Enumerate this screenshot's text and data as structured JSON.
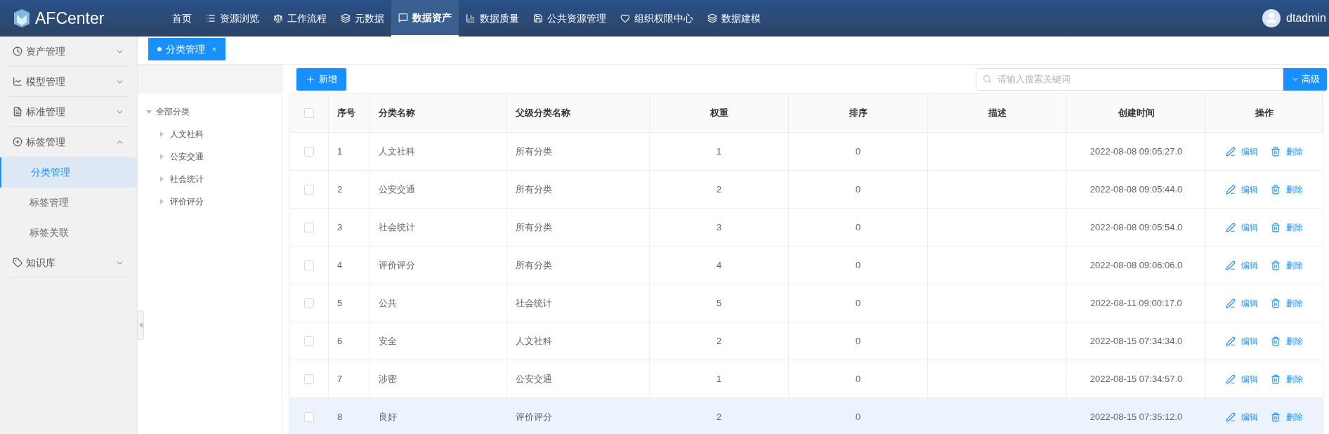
{
  "header": {
    "logo": "AFCenter",
    "nav": [
      {
        "label": "首页",
        "selected": false
      },
      {
        "label": "资源浏览",
        "selected": false
      },
      {
        "label": "工作流程",
        "selected": false
      },
      {
        "label": "元数据",
        "selected": false
      },
      {
        "label": "数据资产",
        "selected": true
      },
      {
        "label": "数据质量",
        "selected": false
      },
      {
        "label": "公共资源管理",
        "selected": false
      },
      {
        "label": "组织权限中心",
        "selected": false
      },
      {
        "label": "数据建模",
        "selected": false
      }
    ],
    "user": "dtadmin"
  },
  "sidebar": {
    "groups": [
      {
        "label": "资产管理",
        "expanded": false
      },
      {
        "label": "模型管理",
        "expanded": false
      },
      {
        "label": "标准管理",
        "expanded": false
      },
      {
        "label": "标签管理",
        "expanded": true,
        "items": [
          {
            "label": "分类管理",
            "selected": true
          },
          {
            "label": "标签管理",
            "selected": false
          },
          {
            "label": "标签关联",
            "selected": false
          }
        ]
      },
      {
        "label": "知识库",
        "expanded": false
      }
    ]
  },
  "open_tabs": [
    {
      "label": "分类管理",
      "close": "×",
      "selected": true
    }
  ],
  "tree": {
    "label": "全部分类",
    "expanded": true,
    "children": [
      {
        "label": "人文社科",
        "expanded": false
      },
      {
        "label": "公安交通",
        "expanded": false
      },
      {
        "label": "社会统计",
        "expanded": false
      },
      {
        "label": "评价评分",
        "expanded": false
      }
    ]
  },
  "toolbar": {
    "add_button": "新增",
    "search": {
      "placeholder": "请输入搜索关键词"
    },
    "advanced_button": "高级"
  },
  "table": {
    "all_checked": false,
    "columns": [
      "序号",
      "分类名称",
      "父级分类名称",
      "权重",
      "排序",
      "描述",
      "创建时间",
      "操作"
    ],
    "rows": [
      {
        "index": "1",
        "name": "人文社科",
        "parent": "所有分类",
        "weight": "1",
        "order": "0",
        "created": "2022-08-08 09:05:27.0",
        "edit": "编辑",
        "delete": "删除",
        "checked": false,
        "selected": false
      },
      {
        "index": "2",
        "name": "公安交通",
        "parent": "所有分类",
        "weight": "2",
        "order": "0",
        "created": "2022-08-08 09:05:44.0",
        "edit": "编辑",
        "delete": "删除",
        "checked": false,
        "selected": false
      },
      {
        "index": "3",
        "name": "社会统计",
        "parent": "所有分类",
        "weight": "3",
        "order": "0",
        "created": "2022-08-08 09:05:54.0",
        "edit": "编辑",
        "delete": "删除",
        "checked": false,
        "selected": false
      },
      {
        "index": "4",
        "name": "评价评分",
        "parent": "所有分类",
        "weight": "4",
        "order": "0",
        "created": "2022-08-08 09:06:06.0",
        "edit": "编辑",
        "delete": "删除",
        "checked": false,
        "selected": false
      },
      {
        "index": "5",
        "name": "公共",
        "parent": "社会统计",
        "weight": "5",
        "order": "0",
        "created": "2022-08-11 09:00:17.0",
        "edit": "编辑",
        "delete": "删除",
        "checked": false,
        "selected": false
      },
      {
        "index": "6",
        "name": "安全",
        "parent": "人文社科",
        "weight": "2",
        "order": "0",
        "created": "2022-08-15 07:34:34.0",
        "edit": "编辑",
        "delete": "删除",
        "checked": false,
        "selected": false
      },
      {
        "index": "7",
        "name": "涉密",
        "parent": "公安交通",
        "weight": "1",
        "order": "0",
        "created": "2022-08-15 07:34:57.0",
        "edit": "编辑",
        "delete": "删除",
        "checked": false,
        "selected": false
      },
      {
        "index": "8",
        "name": "良好",
        "parent": "评价评分",
        "weight": "2",
        "order": "0",
        "created": "2022-08-15 07:35:12.0",
        "edit": "编辑",
        "delete": "删除",
        "checked": false,
        "selected": true
      }
    ]
  }
}
